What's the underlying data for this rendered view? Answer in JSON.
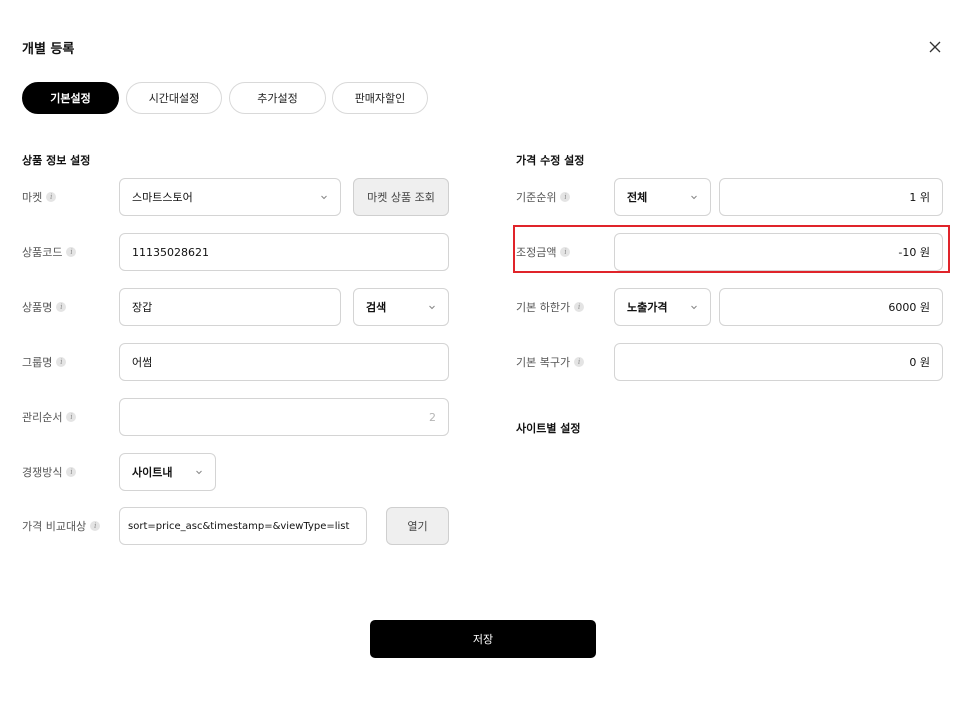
{
  "modal": {
    "title": "개별 등록"
  },
  "tabs": [
    {
      "label": "기본설정",
      "active": true
    },
    {
      "label": "시간대설정",
      "active": false
    },
    {
      "label": "추가설정",
      "active": false
    },
    {
      "label": "판매자할인",
      "active": false
    }
  ],
  "product_info": {
    "title": "상품 정보 설정",
    "market": {
      "label": "마켓",
      "value": "스마트스토어",
      "lookup_button": "마켓 상품 조회"
    },
    "product_code": {
      "label": "상품코드",
      "value": "11135028621"
    },
    "product_name": {
      "label": "상품명",
      "value": "장갑",
      "search_select": "검색"
    },
    "group_name": {
      "label": "그룹명",
      "value": "어썸"
    },
    "management_order": {
      "label": "관리순서",
      "placeholder": "2"
    },
    "competition_method": {
      "label": "경쟁방식",
      "value": "사이트내"
    },
    "price_compare": {
      "label": "가격 비교대상",
      "value": "sort=price_asc&timestamp=&viewType=list",
      "open_button": "열기"
    }
  },
  "price_edit": {
    "title": "가격 수정 설정",
    "base_rank": {
      "label": "기준순위",
      "select": "전체",
      "value": "1 위"
    },
    "adjust_amount": {
      "label": "조정금액",
      "value": "-10 원"
    },
    "base_lower_limit": {
      "label": "기본 하한가",
      "select": "노출가격",
      "value": "6000 원"
    },
    "base_restore_price": {
      "label": "기본 복구가",
      "value": "0 원"
    }
  },
  "site_settings": {
    "title": "사이트별 설정"
  },
  "footer": {
    "save_label": "저장"
  },
  "colors": {
    "primary": "#000000",
    "highlight": "#e0242a"
  }
}
